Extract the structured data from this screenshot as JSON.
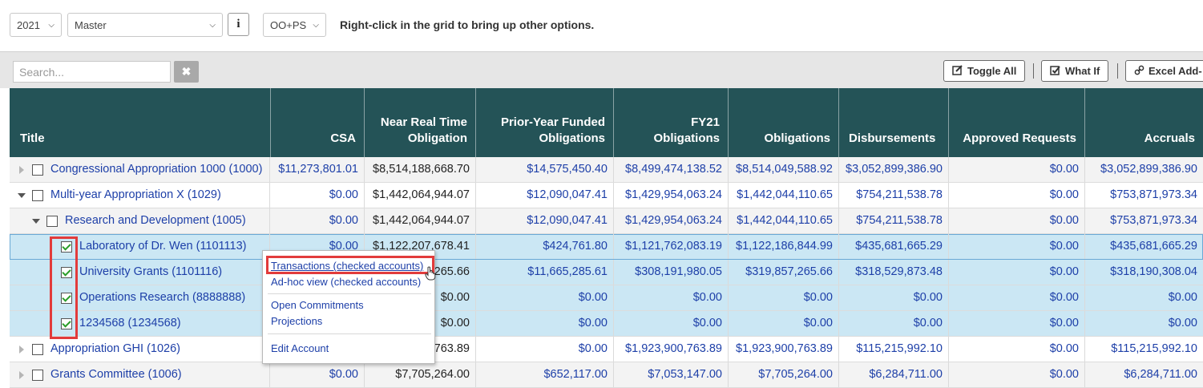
{
  "top": {
    "year": "2021",
    "version": "Master",
    "info_label": "i",
    "mode": "OO+PS",
    "hint": "Right-click in the grid to bring up other options."
  },
  "toolbar": {
    "search_placeholder": "Search...",
    "clear_label": "✖",
    "toggle_all": "Toggle All",
    "what_if": "What If",
    "excel_addin": "Excel Add-"
  },
  "columns": [
    "Title",
    "CSA",
    "Near Real Time Obligation",
    "Prior-Year Funded Obligations",
    "FY21 Obligations",
    "Obligations",
    "Disbursements",
    "Approved Requests",
    "Accruals"
  ],
  "rows": [
    {
      "title": "Congressional Appropriation 1000 (1000)",
      "values": [
        "$11,273,801.01",
        "$8,514,188,668.70",
        "$14,575,450.40",
        "$8,499,474,138.52",
        "$8,514,049,588.92",
        "$3,052,899,386.90",
        "$0.00",
        "$3,052,899,386.90"
      ]
    },
    {
      "title": "Multi-year Appropriation X (1029)",
      "values": [
        "$0.00",
        "$1,442,064,944.07",
        "$12,090,047.41",
        "$1,429,954,063.24",
        "$1,442,044,110.65",
        "$754,211,538.78",
        "$0.00",
        "$753,871,973.34"
      ]
    },
    {
      "title": "Research and Development (1005)",
      "values": [
        "$0.00",
        "$1,442,064,944.07",
        "$12,090,047.41",
        "$1,429,954,063.24",
        "$1,442,044,110.65",
        "$754,211,538.78",
        "$0.00",
        "$753,871,973.34"
      ]
    },
    {
      "title": "Laboratory of Dr. Wen (1101113)",
      "values": [
        "$0.00",
        "$1,122,207,678.41",
        "$424,761.80",
        "$1,121,762,083.19",
        "$1,122,186,844.99",
        "$435,681,665.29",
        "$0.00",
        "$435,681,665.29"
      ]
    },
    {
      "title": "University Grants (1101116)",
      "values": [
        "",
        "265.66",
        "$11,665,285.61",
        "$308,191,980.05",
        "$319,857,265.66",
        "$318,529,873.48",
        "$0.00",
        "$318,190,308.04"
      ]
    },
    {
      "title": "Operations Research (8888888)",
      "values": [
        "",
        "$0.00",
        "$0.00",
        "$0.00",
        "$0.00",
        "$0.00",
        "$0.00",
        "$0.00"
      ]
    },
    {
      "title": "1234568 (1234568)",
      "values": [
        "",
        "$0.00",
        "$0.00",
        "$0.00",
        "$0.00",
        "$0.00",
        "$0.00",
        "$0.00"
      ]
    },
    {
      "title": "Appropriation GHI (1026)",
      "values": [
        "",
        "763.89",
        "$0.00",
        "$1,923,900,763.89",
        "$1,923,900,763.89",
        "$115,215,992.10",
        "$0.00",
        "$115,215,992.10"
      ]
    },
    {
      "title": "Grants Committee (1006)",
      "values": [
        "$0.00",
        "$7,705,264.00",
        "$652,117.00",
        "$7,053,147.00",
        "$7,705,264.00",
        "$6,284,711.00",
        "$0.00",
        "$6,284,711.00"
      ]
    }
  ],
  "context_menu": {
    "transactions": "Transactions (checked accounts)",
    "adhoc": "Ad-hoc view (checked accounts)",
    "open_commitments": "Open Commitments",
    "projections": "Projections",
    "edit_account": "Edit Account"
  }
}
